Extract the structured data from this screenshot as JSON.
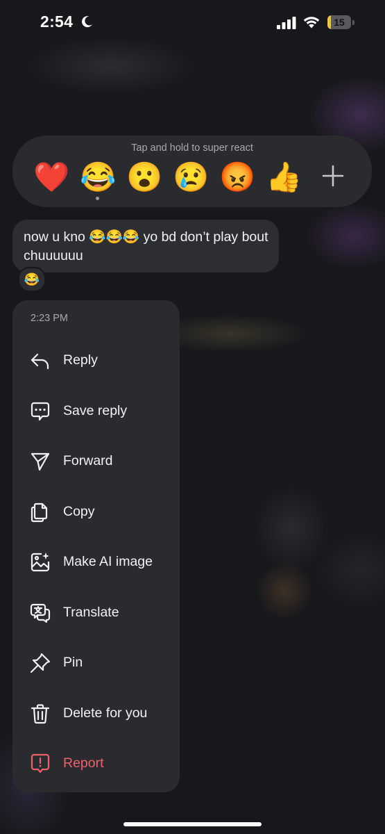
{
  "status_bar": {
    "time": "2:54",
    "battery_level": "15",
    "battery_fraction": 0.15,
    "battery_color": "#e5c64a",
    "icons": [
      "moon-icon",
      "cellular-signal-icon",
      "wifi-icon",
      "battery-icon"
    ]
  },
  "reaction_bar": {
    "hint": "Tap and hold to super react",
    "reactions": [
      {
        "emoji": "❤️",
        "name": "heart"
      },
      {
        "emoji": "😂",
        "name": "laughing",
        "selected": true
      },
      {
        "emoji": "😮",
        "name": "surprised"
      },
      {
        "emoji": "😢",
        "name": "crying"
      },
      {
        "emoji": "😡",
        "name": "angry"
      },
      {
        "emoji": "👍",
        "name": "thumbs-up"
      }
    ],
    "more_icon": "plus-icon"
  },
  "message": {
    "text": "now u kno 😂😂😂 yo bd don’t play bout chuuuuuu",
    "reaction": "😂"
  },
  "menu": {
    "timestamp": "2:23 PM",
    "items": [
      {
        "label": "Reply",
        "icon": "reply-icon"
      },
      {
        "label": "Save reply",
        "icon": "save-reply-icon"
      },
      {
        "label": "Forward",
        "icon": "forward-icon"
      },
      {
        "label": "Copy",
        "icon": "copy-icon"
      },
      {
        "label": "Make AI image",
        "icon": "ai-image-icon"
      },
      {
        "label": "Translate",
        "icon": "translate-icon"
      },
      {
        "label": "Pin",
        "icon": "pin-icon"
      },
      {
        "label": "Delete for you",
        "icon": "trash-icon"
      },
      {
        "label": "Report",
        "icon": "report-icon",
        "destructive": true
      }
    ]
  },
  "colors": {
    "background": "#17181b",
    "panel": "#2a2b2f",
    "bubble": "#2d2e32",
    "text": "#f2f2f4",
    "muted": "#a8a9ae",
    "destructive": "#f0606a"
  }
}
